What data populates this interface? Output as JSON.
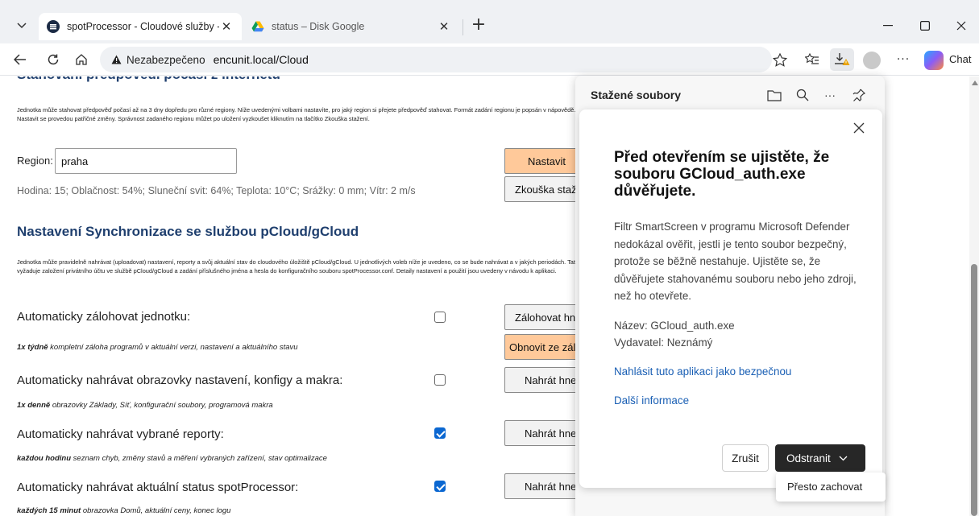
{
  "browser": {
    "tabs": [
      {
        "title": "spotProcessor - Cloudové služby - ",
        "active": true,
        "favicon": "spot-icon"
      },
      {
        "title": "status – Disk Google",
        "active": false,
        "favicon": "google-drive-icon"
      }
    ],
    "address": {
      "security_label": "Nezabezpečeno",
      "url": "encunit.local/Cloud"
    },
    "chat_label": "Chat"
  },
  "page": {
    "section_weather_title": "Stahování předpovědi počasí z internetu",
    "weather_description": "Jednotka může stahovat předpověď počasí až na 3 dny dopředu pro různé regiony. Níže uvedenými volbami nastavíte, pro jaký region si přejete předpověď stahovat. Formát zadání regionu je popsán v nápovědě. Po kliknutí na tlačítko Nastavit se provedou patřičné změny. Správnost zadaného regionu můžet po uložení vyzkoušet kliknutím na tlačítko Zkouška stažení.",
    "region_label": "Region:",
    "region_value": "praha",
    "weather_status": "Hodina: 15; Oblačnost: 54%; Sluneční svit: 64%; Teplota: 10°C; Srážky: 0 mm; Vítr: 2 m/s",
    "set_button": "Nastavit",
    "test_button": "Zkouška stažení",
    "section_sync_title": "Nastavení Synchronizace se službou pCloud/gCloud",
    "sync_description": "Jednotka může pravidelně nahrávat (uploadovat) nastavení, reporty a svůj aktuální stav do cloudového úložiště pCloud/gCloud. U jednotlivých voleb níže je uvedeno, co se bude nahrávat a v jakých periodách. Tato funkcionalita vyžaduje založení privátního účtu ve službě pCloud/gCloud a zadání příslušného jména a hesla do konfiguračního souboru spotProcessor.conf. Detaily nastavení a použití jsou uvedeny v návodu k aplikaci.",
    "rows": [
      {
        "label": "Automaticky zálohovat jednotku:",
        "note_bold": "1x týdně",
        "note": " kompletní záloha programů v aktuální verzi, nastavení a aktuálního stavu",
        "checked": false,
        "button": "Zálohovat hned",
        "button2": "Obnovit ze zálohy"
      },
      {
        "label": "Automaticky nahrávat obrazovky nastavení, konfigy a makra:",
        "note_bold": "1x denně",
        "note": " obrazovky Základy, Síť, konfigurační soubory, programová makra",
        "checked": false,
        "button": "Nahrát hned"
      },
      {
        "label": "Automaticky nahrávat vybrané reporty:",
        "note_bold": "každou hodinu",
        "note": " seznam chyb, změny stavů a měření vybraných zařízení, stav optimalizace",
        "checked": true,
        "button": "Nahrát hned"
      },
      {
        "label": "Automaticky nahrávat aktuální status spotProcessor:",
        "note_bold": "každých 15 minut",
        "note": " obrazovka Domů, aktuální ceny, konec logu",
        "checked": true,
        "button": "Nahrát hned"
      }
    ]
  },
  "downloads": {
    "title": "Stažené soubory",
    "dialog": {
      "title": "Před otevřením se ujistěte, že souboru GCloud_auth.exe důvěřujete.",
      "body": "Filtr SmartScreen v programu Microsoft Defender nedokázal ověřit, jestli je tento soubor bezpečný, protože se běžně nestahuje. Ujistěte se, že důvěřujete stahovanému souboru nebo jeho zdroji, než ho otevřete.",
      "name_line": "Název: GCloud_auth.exe",
      "publisher_line": "Vydavatel: Neznámý",
      "report_link": "Nahlásit tuto aplikaci jako bezpečnou",
      "more_link": "Další informace",
      "cancel": "Zrušit",
      "delete": "Odstranit",
      "keep_anyway": "Přesto zachovat"
    }
  },
  "colors": {
    "heading": "#1f3f6e",
    "button_orange": "#ffc99a",
    "link": "#1a5fb4",
    "delete_button": "#272727",
    "checkbox_checked": "#0b67d1"
  }
}
